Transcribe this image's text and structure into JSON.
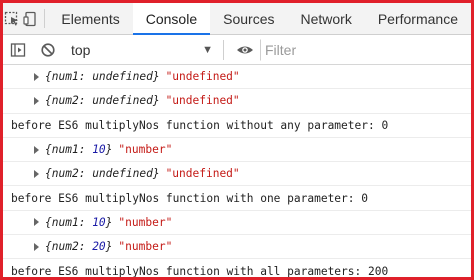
{
  "tabs": [
    {
      "label": "Elements"
    },
    {
      "label": "Console"
    },
    {
      "label": "Sources"
    },
    {
      "label": "Network"
    },
    {
      "label": "Performance"
    }
  ],
  "toolbar": {
    "context": "top",
    "filter_placeholder": "Filter"
  },
  "log": [
    {
      "kind": "obj",
      "key": "num1",
      "value": "undefined",
      "str": "\"undefined\""
    },
    {
      "kind": "obj",
      "key": "num2",
      "value": "undefined",
      "str": "\"undefined\""
    },
    {
      "kind": "text",
      "text": "before ES6 multiplyNos function without any parameter: 0"
    },
    {
      "kind": "obj",
      "key": "num1",
      "value": "10",
      "str": "\"number\""
    },
    {
      "kind": "obj",
      "key": "num2",
      "value": "undefined",
      "str": "\"undefined\""
    },
    {
      "kind": "text",
      "text": "before ES6 multiplyNos function with one parameter: 0"
    },
    {
      "kind": "obj",
      "key": "num1",
      "value": "10",
      "str": "\"number\""
    },
    {
      "kind": "obj",
      "key": "num2",
      "value": "20",
      "str": "\"number\""
    },
    {
      "kind": "text",
      "text": "before ES6 multiplyNos function with all parameters: 200"
    }
  ]
}
